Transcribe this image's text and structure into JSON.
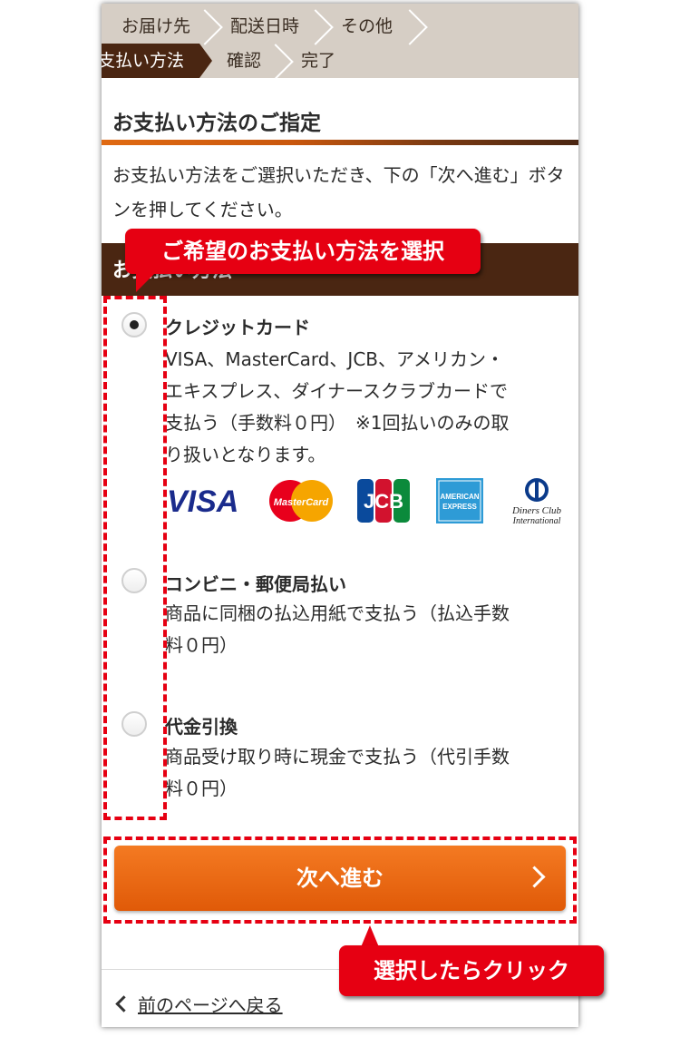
{
  "steps": {
    "row1": [
      "お届け先",
      "配送日時",
      "その他"
    ],
    "row2": [
      "支払い方法",
      "確認",
      "完了"
    ],
    "active": "支払い方法"
  },
  "page": {
    "title": "お支払い方法のご指定",
    "description": "お支払い方法をご選択いただき、下の「次へ進む」ボタンを押してください。",
    "section_label": "お支払い方法"
  },
  "options": [
    {
      "title": "クレジットカード",
      "lines": [
        "VISA、MasterCard、JCB、アメリカン・",
        "エキスプレス、ダイナースクラブカードで",
        "支払う（手数料０円）　※1回払いのみの取",
        "り扱いとなります。"
      ],
      "checked": true
    },
    {
      "title": "コンビニ・郵便局払い",
      "lines": [
        "商品に同梱の払込用紙で支払う（払込手数",
        "料０円）"
      ],
      "checked": false
    },
    {
      "title": "代金引換",
      "lines": [
        "商品受け取り時に現金で支払う（代引手数",
        "料０円）"
      ],
      "checked": false
    }
  ],
  "cards": {
    "visa": "VISA",
    "mastercard": "MasterCard",
    "jcb": "JCB",
    "amex_line1": "AMERICAN",
    "amex_line2": "EXPRESS",
    "diners_line1": "Diners Club",
    "diners_line2": "International"
  },
  "buttons": {
    "next": "次へ進む",
    "back": "前のページへ戻る"
  },
  "annotations": {
    "select_hint": "ご希望のお支払い方法を選択",
    "click_hint": "選択したらクリック"
  },
  "colors": {
    "brown": "#4a2612",
    "orange": "#f47a22",
    "annotation_red": "#e60012",
    "step_bg": "#d6cec5"
  }
}
